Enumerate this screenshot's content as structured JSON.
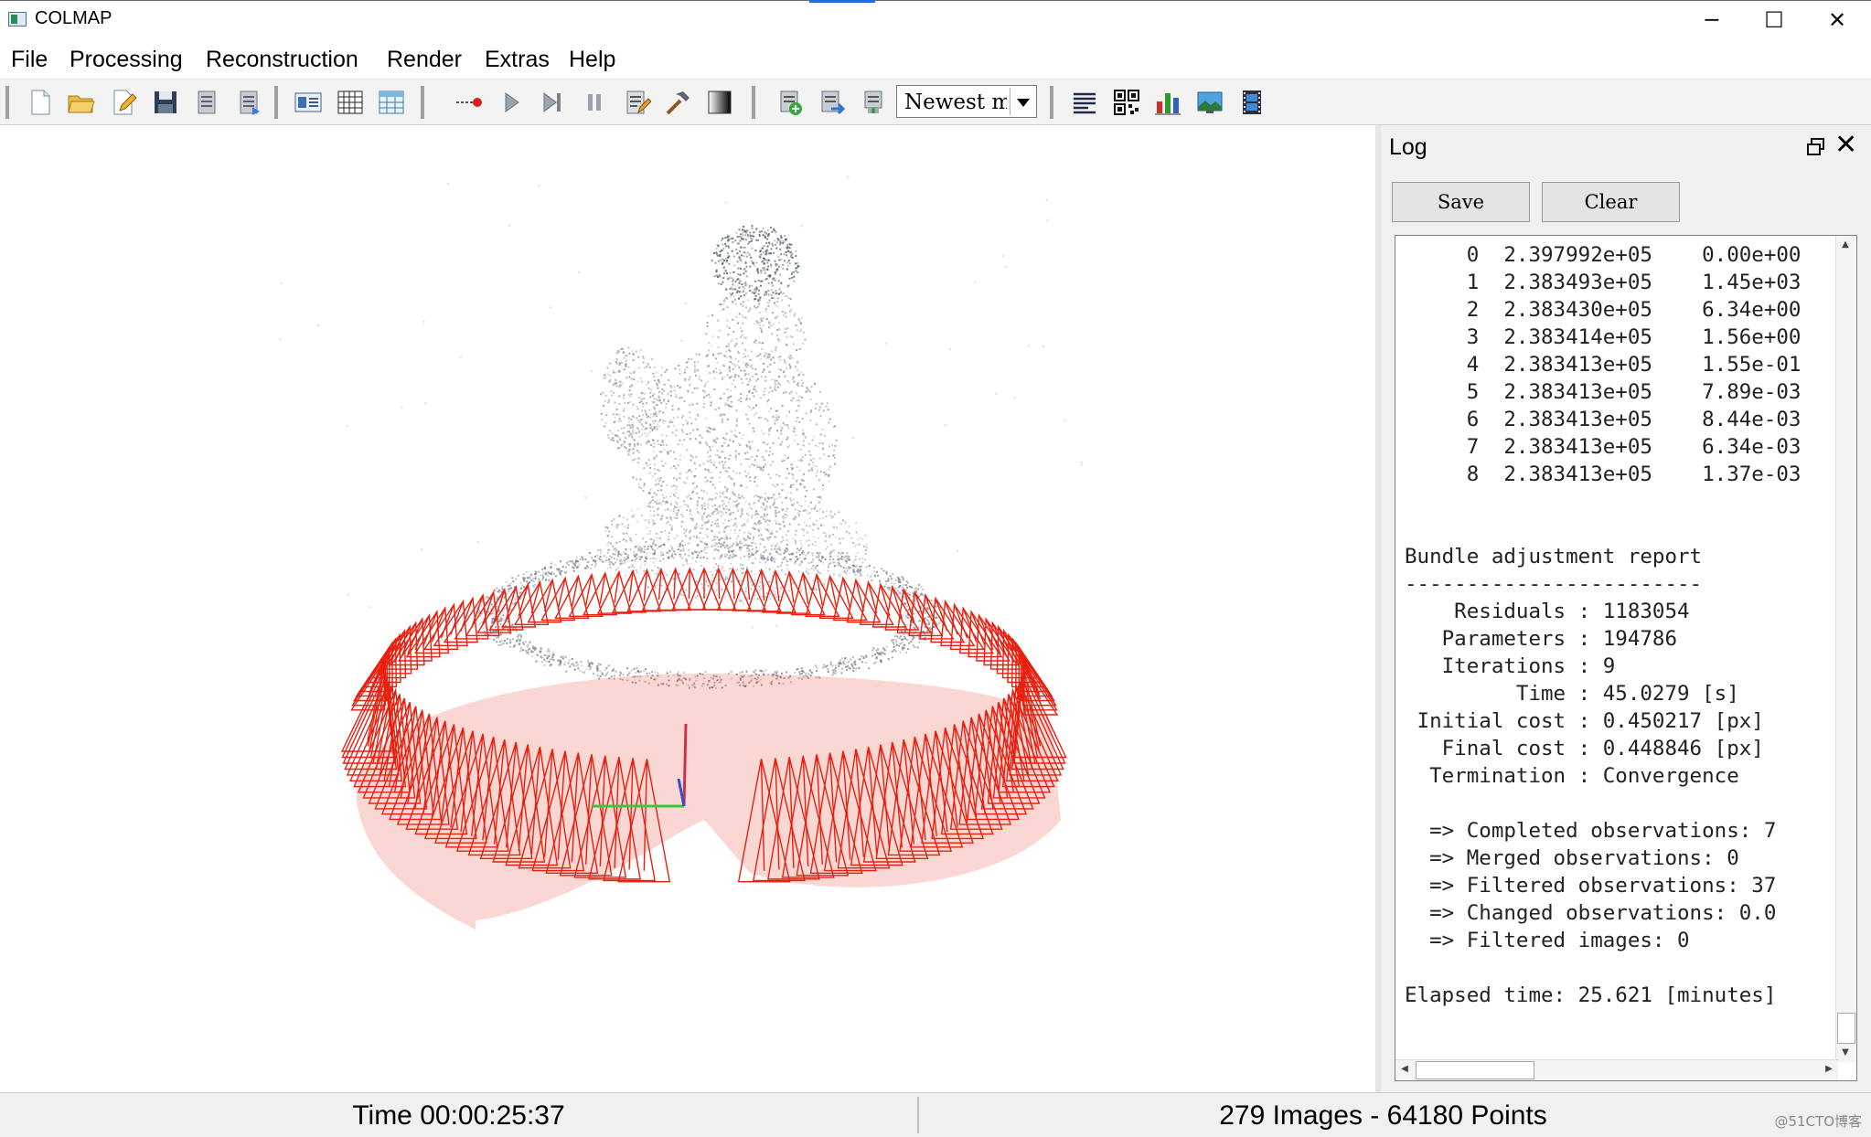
{
  "window": {
    "title": "COLMAP",
    "minimize_glyph": "─",
    "maximize_glyph": "☐",
    "close_glyph": "✕"
  },
  "menu": {
    "items": [
      "File",
      "Processing",
      "Reconstruction",
      "Render",
      "Extras",
      "Help"
    ]
  },
  "toolbar": {
    "icons": [
      "new-project-icon",
      "open-project-icon",
      "edit-project-icon",
      "save-project-icon",
      "import-model-icon",
      "export-model-icon",
      "feature-extraction-icon",
      "feature-matching-icon",
      "database-management-icon",
      "automatic-reconstruction-icon",
      "start-reconstruction-icon",
      "step-reconstruction-icon",
      "pause-reconstruction-icon",
      "reconstruction-options-icon",
      "bundle-adjustment-icon",
      "dense-reconstruction-icon",
      "render-toggle-icon",
      "render-options-icon",
      "reset-view-icon",
      "reconstruction-stats-icon",
      "match-matrix-icon",
      "reconstruction-stats-chart-icon",
      "grab-image-icon",
      "grab-movie-icon"
    ],
    "model_select": "Newest model"
  },
  "log": {
    "title": "Log",
    "save_label": "Save",
    "clear_label": "Clear",
    "lines": [
      "     0  2.397992e+05    0.00e+00",
      "     1  2.383493e+05    1.45e+03",
      "     2  2.383430e+05    6.34e+00",
      "     3  2.383414e+05    1.56e+00",
      "     4  2.383413e+05    1.55e-01",
      "     5  2.383413e+05    7.89e-03",
      "     6  2.383413e+05    8.44e-03",
      "     7  2.383413e+05    6.34e-03",
      "     8  2.383413e+05    1.37e-03",
      "",
      "",
      "Bundle adjustment report",
      "------------------------",
      "    Residuals : 1183054",
      "   Parameters : 194786",
      "   Iterations : 9",
      "         Time : 45.0279 [s]",
      " Initial cost : 0.450217 [px]",
      "   Final cost : 0.448846 [px]",
      "  Termination : Convergence",
      "",
      "  => Completed observations: 7",
      "  => Merged observations: 0",
      "  => Filtered observations: 37",
      "  => Changed observations: 0.0",
      "  => Filtered images: 0",
      "",
      "Elapsed time: 25.621 [minutes]"
    ]
  },
  "status": {
    "time": "Time 00:00:25:37",
    "summary": "279 Images - 64180 Points",
    "watermark": "@51CTO博客"
  },
  "colors": {
    "camera": "#e8200f",
    "points": "#9aa0a8",
    "axis_x": "#d0304a",
    "axis_y": "#3cc43c",
    "axis_z": "#3050d0",
    "accent": "#1e6fd9"
  }
}
